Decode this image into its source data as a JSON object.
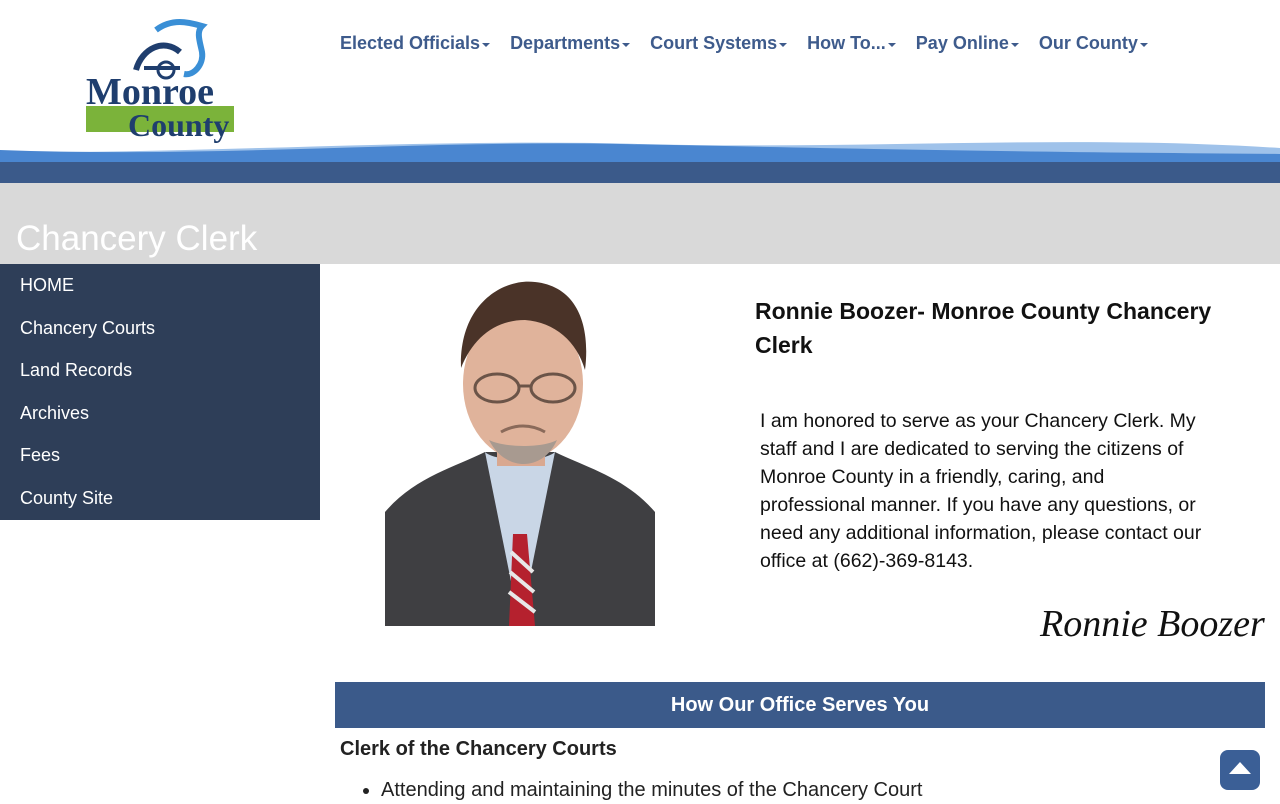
{
  "logo": {
    "line1": "Monroe",
    "line2": "County"
  },
  "nav": [
    {
      "label": "Elected Officials"
    },
    {
      "label": "Departments"
    },
    {
      "label": "Court Systems"
    },
    {
      "label": "How To..."
    },
    {
      "label": "Pay Online"
    },
    {
      "label": "Our County"
    }
  ],
  "page": {
    "title": "Chancery Clerk"
  },
  "sidebar": {
    "items": [
      {
        "label": "HOME"
      },
      {
        "label": "Chancery Courts"
      },
      {
        "label": "Land Records"
      },
      {
        "label": "Archives"
      },
      {
        "label": "Fees"
      },
      {
        "label": "County Site"
      }
    ]
  },
  "bio": {
    "heading": "Ronnie Boozer- Monroe County Chancery Clerk",
    "text": "I am honored to serve as your Chancery Clerk.  My staff and I are dedicated to serving the citizens of Monroe County in a friendly, caring, and professional manner.  If you have any questions, or need any additional information, please contact our office at (662)-369-8143.",
    "signature": "Ronnie Boozer"
  },
  "section": {
    "title": "How Our Office Serves You",
    "subheading": "Clerk of the Chancery Courts",
    "bullets": [
      "Attending and maintaining the minutes of the Chancery Court"
    ]
  },
  "colors": {
    "nav": "#3e5b8c",
    "sidebar": "#2e3e58",
    "title_band": "#d9d9d9",
    "section_bar": "#3b5a8a"
  },
  "icons": {
    "back_to_top": "arrow-up-icon",
    "nav_caret": "chevron-down-icon"
  }
}
